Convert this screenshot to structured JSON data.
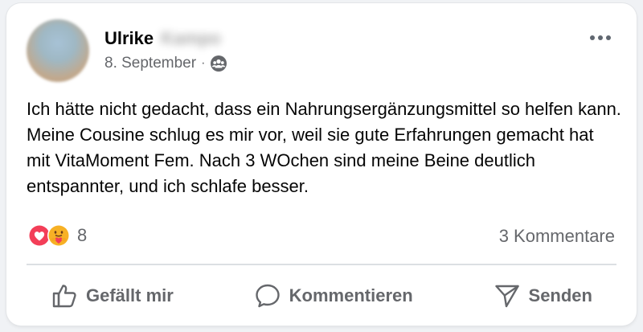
{
  "post": {
    "author": {
      "first_name": "Ulrike",
      "last_name_blurred": "Kampo"
    },
    "date": "8. September",
    "separator": "·",
    "audience_icon": "group-icon",
    "text": "Ich hätte nicht gedacht, dass ein Nahrungsergänzungsmittel so helfen kann. Meine Cousine schlug es mir vor, weil sie gute Erfahrungen gemacht hat mit VitaMoment Fem. Nach 3 WOchen sind meine Beine deutlich entspannter, und ich schlafe besser.",
    "reactions": {
      "icons": [
        "love-reaction-icon",
        "care-reaction-icon"
      ],
      "count": "8"
    },
    "comments_count": "3 Kommentare"
  },
  "actions": {
    "like_label": "Gefällt mir",
    "comment_label": "Kommentieren",
    "share_label": "Senden"
  },
  "colors": {
    "text_primary": "#050505",
    "text_secondary": "#65676b",
    "love": "#f33e58",
    "care": "#f7b125",
    "divider": "#dcdfe3"
  }
}
